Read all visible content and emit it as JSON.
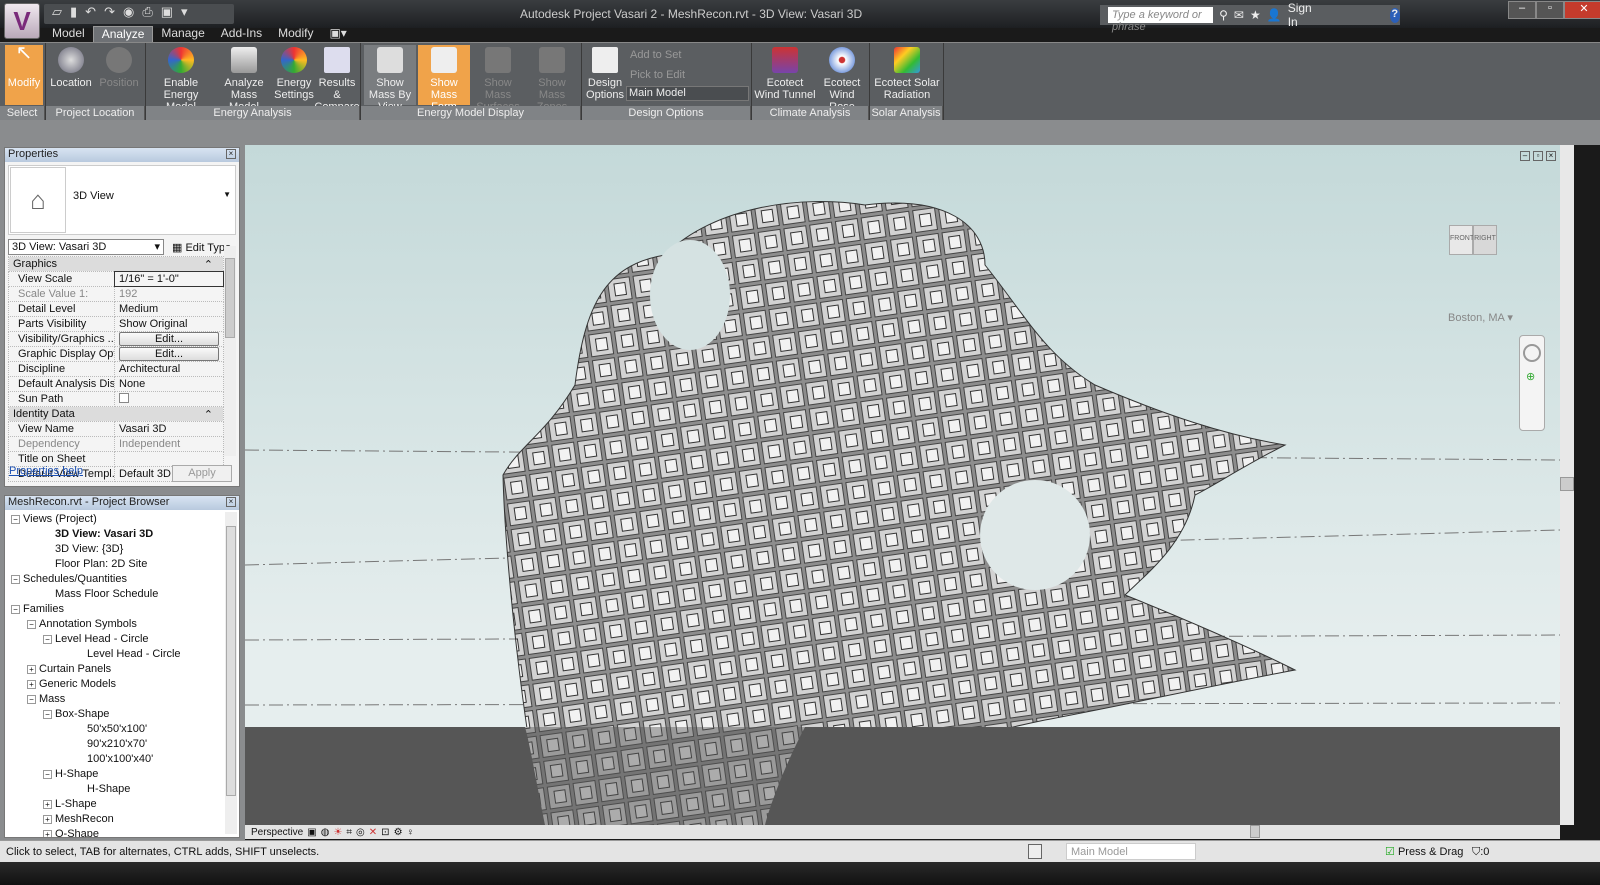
{
  "app": {
    "title": "Autodesk Project Vasari 2 -    MeshRecon.rvt - 3D View: Vasari 3D",
    "logo": "V"
  },
  "search": {
    "placeholder": "Type a keyword or phrase",
    "sign_in": "Sign In",
    "help": "?"
  },
  "tabs": [
    "Model",
    "Analyze",
    "Manage",
    "Add-Ins",
    "Modify",
    "▣▾"
  ],
  "active_tab": "Analyze",
  "ribbon": {
    "panels": [
      "Select",
      "Project Location",
      "Energy Analysis",
      "Energy Model Display",
      "Design Options",
      "Climate Analysis",
      "Solar Analysis"
    ],
    "buttons": {
      "modify": "Modify",
      "location": "Location",
      "position": "Position",
      "enable_energy": "Enable Energy Model",
      "analyze_mass": "Analyze Mass Model",
      "energy_settings": "Energy Settings",
      "results": "Results & Compare",
      "show_by_view": "Show Mass By View",
      "show_form": "Show Mass Form",
      "show_surfaces": "Show Mass Surfaces",
      "show_zones": "Show Mass Zones",
      "design_options": "Design Options",
      "add_to_set": "Add to Set",
      "pick_to_edit": "Pick to Edit",
      "design_option_value": "Main Model",
      "wind_tunnel": "Ecotect Wind Tunnel",
      "wind_rose": "Ecotect Wind Rose",
      "solar_radiation": "Ecotect Solar Radiation"
    }
  },
  "properties": {
    "title": "Properties",
    "type_name": "3D View",
    "instance": "3D View: Vasari 3D",
    "edit_type": "Edit Type",
    "rows": [
      {
        "group": "Graphics"
      },
      {
        "k": "View Scale",
        "v": "1/16\" = 1'-0\""
      },
      {
        "k": "Scale Value    1:",
        "v": "192",
        "gray": true
      },
      {
        "k": "Detail Level",
        "v": "Medium"
      },
      {
        "k": "Parts Visibility",
        "v": "Show Original"
      },
      {
        "k": "Visibility/Graphics ...",
        "v": "Edit...",
        "btn": true
      },
      {
        "k": "Graphic Display Opt...",
        "v": "Edit...",
        "btn": true
      },
      {
        "k": "Discipline",
        "v": "Architectural"
      },
      {
        "k": "Default Analysis Dis...",
        "v": "None"
      },
      {
        "k": "Sun Path",
        "v": "",
        "check": true
      },
      {
        "group": "Identity Data"
      },
      {
        "k": "View Name",
        "v": "Vasari 3D"
      },
      {
        "k": "Dependency",
        "v": "Independent",
        "gray": true
      },
      {
        "k": "Title on Sheet",
        "v": ""
      },
      {
        "k": "Default View Templ...",
        "v": "Default 3D"
      }
    ],
    "help": "Properties help",
    "apply": "Apply"
  },
  "browser": {
    "title": "MeshRecon.rvt - Project Browser",
    "items": [
      {
        "t": "Views (Project)",
        "l": 0,
        "pm": "−"
      },
      {
        "t": "3D View: Vasari 3D",
        "l": 2,
        "bold": true
      },
      {
        "t": "3D View: {3D}",
        "l": 2
      },
      {
        "t": "Floor Plan: 2D Site",
        "l": 2
      },
      {
        "t": "Schedules/Quantities",
        "l": 0,
        "pm": "−"
      },
      {
        "t": "Mass Floor Schedule",
        "l": 2
      },
      {
        "t": "Families",
        "l": 0,
        "pm": "−"
      },
      {
        "t": "Annotation Symbols",
        "l": 1,
        "pm": "−"
      },
      {
        "t": "Level Head - Circle",
        "l": 2,
        "pm": "−"
      },
      {
        "t": "Level Head - Circle",
        "l": 4
      },
      {
        "t": "Curtain Panels",
        "l": 1,
        "pm": "+"
      },
      {
        "t": "Generic Models",
        "l": 1,
        "pm": "+"
      },
      {
        "t": "Mass",
        "l": 1,
        "pm": "−"
      },
      {
        "t": "Box-Shape",
        "l": 2,
        "pm": "−"
      },
      {
        "t": "50'x50'x100'",
        "l": 4
      },
      {
        "t": "90'x210'x70'",
        "l": 4
      },
      {
        "t": "100'x100'x40'",
        "l": 4
      },
      {
        "t": "H-Shape",
        "l": 2,
        "pm": "−"
      },
      {
        "t": "H-Shape",
        "l": 4
      },
      {
        "t": "L-Shape",
        "l": 2,
        "pm": "+"
      },
      {
        "t": "MeshRecon",
        "l": 2,
        "pm": "+"
      },
      {
        "t": "O-Shape",
        "l": 2,
        "pm": "+"
      }
    ]
  },
  "viewport": {
    "viewcube_front": "FRONT",
    "viewcube_right": "RIGHT",
    "location": "Boston, MA"
  },
  "view_bar": {
    "mode": "Perspective"
  },
  "status": {
    "text": "Click to select, TAB for alternates, CTRL adds, SHIFT unselects.",
    "model": "Main Model",
    "press_drag": "Press & Drag",
    "filter": ":0"
  }
}
